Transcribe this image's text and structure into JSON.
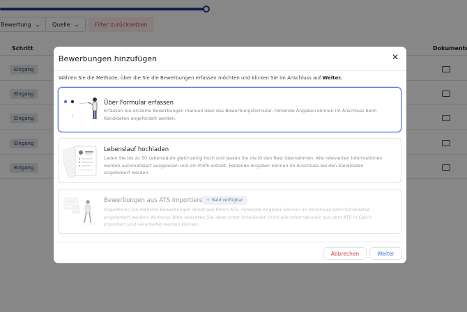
{
  "background": {
    "filters": {
      "bewertung": "Bewertung",
      "quelle": "Quelle",
      "reset": "Filter zurücksetzen"
    },
    "table": {
      "col_schritt": "Schritt",
      "col_dokumente": "Dokumente",
      "rows": [
        "Eingang",
        "Eingang",
        "Eingang",
        "Eingang",
        "Eingang"
      ]
    }
  },
  "modal": {
    "title": "Bewerbungen hinzufügen",
    "close_icon": "close-icon",
    "intro_prefix": "Wählen Sie die Methode, über die Sie die Bewerbungen erfassen möchten und klicken Sie im Anschluss auf ",
    "intro_bold": "Weiter.",
    "options": [
      {
        "title": "Über Formular erfassen",
        "description": "Erfassen Sie einzelne Bewerbungen manuell über das Bewerbungsformular. Fehlende Angaben können im Anschluss beim Kandidaten angefordert werden.",
        "selected": true,
        "disabled": false
      },
      {
        "title": "Lebenslauf hochladen",
        "description": "Laden Sie bis zu 50 Lebensläufe gleichzeitig hoch und lassen Sie die KI den Rest übernehmen. Alle relevanten Informationen werden automatisiert ausgelesen und ein Profil erstellt. Fehlende Angaben können im Anschluss bei den Kandidaten angefordert werden.",
        "selected": false,
        "disabled": false
      },
      {
        "title": "Bewerbungen aus ATS importieren",
        "badge": "Bald verfügbar",
        "description": "Importieren Sie mehrere Bewerbungen direkt aus Ihrem ATS. Fehlende Angaben können im Anschluss beim Kandidaten angefordert werden. Achtung: Bitte beachten Sie, dass unter Umständen nicht alle Informationen aus dem ATS in Catch importiert und verarbeitet werden können.",
        "selected": false,
        "disabled": true
      }
    ],
    "cancel_label": "Abbrechen",
    "next_label": "Weiter"
  },
  "colors": {
    "accent": "#4a6fd0",
    "danger": "#d04b4b",
    "progress": "#2a3a8c"
  }
}
